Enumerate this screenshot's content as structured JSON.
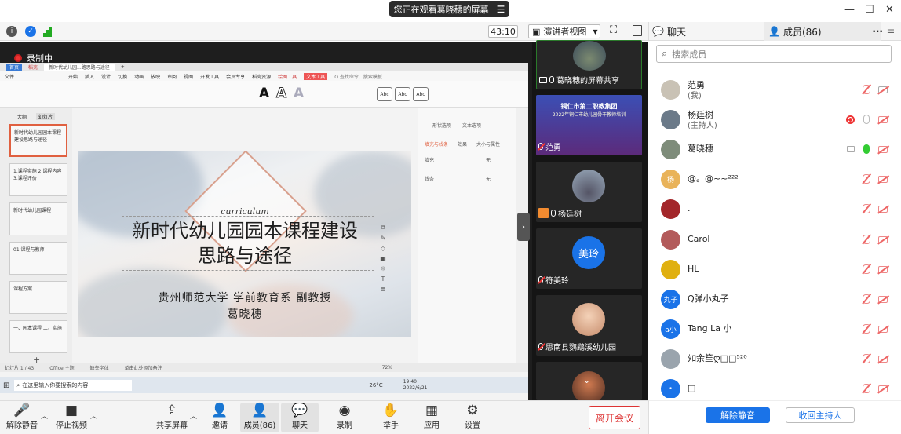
{
  "banner": {
    "text": "您正在观看葛晓穗的屏幕",
    "menu_icon": "menu-icon"
  },
  "window_controls": {
    "min": "—",
    "max": "☐",
    "close": "✕"
  },
  "topbar": {
    "timer": "43:10",
    "view_label": "演讲者视图"
  },
  "recording": {
    "label": "录制中"
  },
  "wps": {
    "tabs": [
      "首页",
      "稻壳",
      "新时代幼儿园...路思路与途径"
    ],
    "menu": [
      "文件",
      "开始",
      "插入",
      "设计",
      "切换",
      "动画",
      "放映",
      "审阅",
      "视图",
      "开发工具",
      "会员专享",
      "稻壳资源",
      "绘图工具",
      "文本工具"
    ],
    "search_hint": "Q 查找命令、搜索模板",
    "left_tabs": [
      "大纲",
      "幻灯片"
    ],
    "thumbs": [
      "新时代幼儿园园本课程建设思路与途径",
      "1.课程实施 2.课程内容 3.课程评价",
      "新时代幼儿园课程",
      "01 课程与教师",
      "课程方案",
      "一、园本课程 二、实施"
    ],
    "right_tabs": [
      "形状选项",
      "文本选项"
    ],
    "right_subtabs": [
      "填充与线条",
      "效果",
      "大小与属性"
    ],
    "right_rows": [
      {
        "label": "填充",
        "value": "无"
      },
      {
        "label": "线条",
        "value": "无"
      }
    ],
    "status": [
      "幻灯片 1 / 43",
      "Office 主题",
      "缺失字体",
      "单击此处添加备注"
    ],
    "zoom": "72%",
    "taskbar_search": "在这里输入你要搜索的内容",
    "taskbar_weather": "26°C",
    "taskbar_time": "19:40",
    "taskbar_date": "2022/6/21"
  },
  "slide": {
    "english": "curriculum",
    "title_line1": "新时代幼儿园园本课程建设",
    "title_line2": "思路与途径",
    "sub_line1": "贵州师范大学 学前教育系 副教授",
    "sub_line2": "葛晓穗"
  },
  "videos": [
    {
      "name": "葛晓穗的屏幕共享",
      "badge_icon": "screen-share-icon",
      "mic": "on"
    },
    {
      "name": "范勇",
      "mic": "off",
      "banner_text": "铜仁市第二职教集团",
      "banner_sub": "2022年铜仁市幼儿园骨干教师培训"
    },
    {
      "name": "杨廷树",
      "mic": "on"
    },
    {
      "name": "符美玲",
      "mic": "off",
      "avatar_text": "美玲"
    },
    {
      "name": "思南县鹦鹉溪幼儿园",
      "mic": "off"
    }
  ],
  "panel": {
    "tab_chat": "聊天",
    "tab_members": "成员(86)",
    "more": "···",
    "search_placeholder": "搜索成员"
  },
  "participants": [
    {
      "name": "范勇",
      "sub": "(我)",
      "avatar": "",
      "color": "#c9c2b5"
    },
    {
      "name": "杨廷树",
      "sub": "(主持人)",
      "avatar": "",
      "color": "#6b7a89"
    },
    {
      "name": "葛晓穗",
      "sub": "",
      "avatar": "",
      "color": "#7e8c7a"
    },
    {
      "name": "@。@~~²²²",
      "sub": "",
      "avatar": "杨",
      "color": "#e9b35a"
    },
    {
      "name": ".",
      "sub": "",
      "avatar": "",
      "color": "#a3262a"
    },
    {
      "name": "Carol",
      "sub": "",
      "avatar": "",
      "color": "#b35a5a"
    },
    {
      "name": "HL",
      "sub": "",
      "avatar": "",
      "color": "#e0b010"
    },
    {
      "name": "Q弹小丸子",
      "sub": "",
      "avatar": "丸子",
      "color": "#1a73e8"
    },
    {
      "name": "Tang La 小",
      "sub": "",
      "avatar": "a小",
      "color": "#1a73e8"
    },
    {
      "name": "ﾀﾛ余笙ღ□□⁵²⁰",
      "sub": "",
      "avatar": "",
      "color": "#9aa4ad"
    },
    {
      "name": "□",
      "sub": "",
      "avatar": "•",
      "color": "#1a73e8"
    }
  ],
  "toolbar": {
    "mute": "解除静音",
    "video": "停止视频",
    "share": "共享屏幕",
    "invite": "邀请",
    "members": "成员(86)",
    "chat": "聊天",
    "record": "录制",
    "raise": "举手",
    "apps": "应用",
    "settings": "设置",
    "leave": "离开会议"
  },
  "panel_buttons": {
    "unmute_all": "解除静音",
    "reclaim_host": "收回主持人"
  },
  "colors": {
    "accent": "#1a73e8",
    "danger": "#d33333"
  }
}
